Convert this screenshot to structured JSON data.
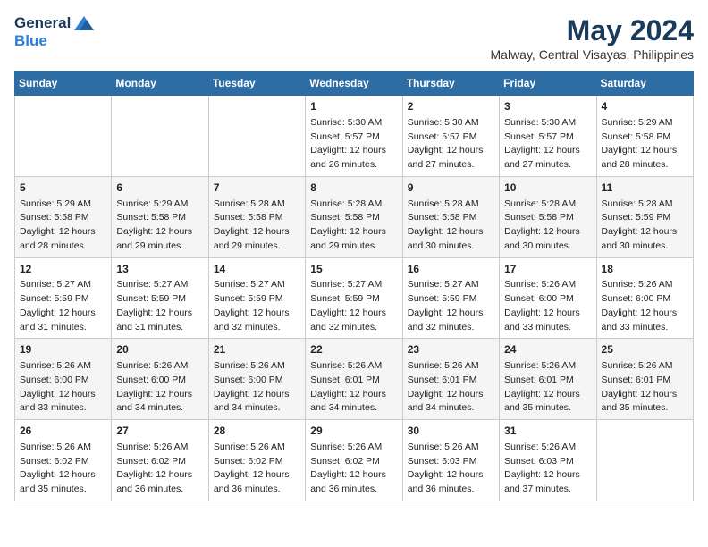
{
  "logo": {
    "general": "General",
    "blue": "Blue"
  },
  "title": "May 2024",
  "subtitle": "Malway, Central Visayas, Philippines",
  "days": [
    "Sunday",
    "Monday",
    "Tuesday",
    "Wednesday",
    "Thursday",
    "Friday",
    "Saturday"
  ],
  "weeks": [
    [
      {
        "day": "",
        "data": ""
      },
      {
        "day": "",
        "data": ""
      },
      {
        "day": "",
        "data": ""
      },
      {
        "day": "1",
        "data": "Sunrise: 5:30 AM\nSunset: 5:57 PM\nDaylight: 12 hours\nand 26 minutes."
      },
      {
        "day": "2",
        "data": "Sunrise: 5:30 AM\nSunset: 5:57 PM\nDaylight: 12 hours\nand 27 minutes."
      },
      {
        "day": "3",
        "data": "Sunrise: 5:30 AM\nSunset: 5:57 PM\nDaylight: 12 hours\nand 27 minutes."
      },
      {
        "day": "4",
        "data": "Sunrise: 5:29 AM\nSunset: 5:58 PM\nDaylight: 12 hours\nand 28 minutes."
      }
    ],
    [
      {
        "day": "5",
        "data": "Sunrise: 5:29 AM\nSunset: 5:58 PM\nDaylight: 12 hours\nand 28 minutes."
      },
      {
        "day": "6",
        "data": "Sunrise: 5:29 AM\nSunset: 5:58 PM\nDaylight: 12 hours\nand 29 minutes."
      },
      {
        "day": "7",
        "data": "Sunrise: 5:28 AM\nSunset: 5:58 PM\nDaylight: 12 hours\nand 29 minutes."
      },
      {
        "day": "8",
        "data": "Sunrise: 5:28 AM\nSunset: 5:58 PM\nDaylight: 12 hours\nand 29 minutes."
      },
      {
        "day": "9",
        "data": "Sunrise: 5:28 AM\nSunset: 5:58 PM\nDaylight: 12 hours\nand 30 minutes."
      },
      {
        "day": "10",
        "data": "Sunrise: 5:28 AM\nSunset: 5:58 PM\nDaylight: 12 hours\nand 30 minutes."
      },
      {
        "day": "11",
        "data": "Sunrise: 5:28 AM\nSunset: 5:59 PM\nDaylight: 12 hours\nand 30 minutes."
      }
    ],
    [
      {
        "day": "12",
        "data": "Sunrise: 5:27 AM\nSunset: 5:59 PM\nDaylight: 12 hours\nand 31 minutes."
      },
      {
        "day": "13",
        "data": "Sunrise: 5:27 AM\nSunset: 5:59 PM\nDaylight: 12 hours\nand 31 minutes."
      },
      {
        "day": "14",
        "data": "Sunrise: 5:27 AM\nSunset: 5:59 PM\nDaylight: 12 hours\nand 32 minutes."
      },
      {
        "day": "15",
        "data": "Sunrise: 5:27 AM\nSunset: 5:59 PM\nDaylight: 12 hours\nand 32 minutes."
      },
      {
        "day": "16",
        "data": "Sunrise: 5:27 AM\nSunset: 5:59 PM\nDaylight: 12 hours\nand 32 minutes."
      },
      {
        "day": "17",
        "data": "Sunrise: 5:26 AM\nSunset: 6:00 PM\nDaylight: 12 hours\nand 33 minutes."
      },
      {
        "day": "18",
        "data": "Sunrise: 5:26 AM\nSunset: 6:00 PM\nDaylight: 12 hours\nand 33 minutes."
      }
    ],
    [
      {
        "day": "19",
        "data": "Sunrise: 5:26 AM\nSunset: 6:00 PM\nDaylight: 12 hours\nand 33 minutes."
      },
      {
        "day": "20",
        "data": "Sunrise: 5:26 AM\nSunset: 6:00 PM\nDaylight: 12 hours\nand 34 minutes."
      },
      {
        "day": "21",
        "data": "Sunrise: 5:26 AM\nSunset: 6:00 PM\nDaylight: 12 hours\nand 34 minutes."
      },
      {
        "day": "22",
        "data": "Sunrise: 5:26 AM\nSunset: 6:01 PM\nDaylight: 12 hours\nand 34 minutes."
      },
      {
        "day": "23",
        "data": "Sunrise: 5:26 AM\nSunset: 6:01 PM\nDaylight: 12 hours\nand 34 minutes."
      },
      {
        "day": "24",
        "data": "Sunrise: 5:26 AM\nSunset: 6:01 PM\nDaylight: 12 hours\nand 35 minutes."
      },
      {
        "day": "25",
        "data": "Sunrise: 5:26 AM\nSunset: 6:01 PM\nDaylight: 12 hours\nand 35 minutes."
      }
    ],
    [
      {
        "day": "26",
        "data": "Sunrise: 5:26 AM\nSunset: 6:02 PM\nDaylight: 12 hours\nand 35 minutes."
      },
      {
        "day": "27",
        "data": "Sunrise: 5:26 AM\nSunset: 6:02 PM\nDaylight: 12 hours\nand 36 minutes."
      },
      {
        "day": "28",
        "data": "Sunrise: 5:26 AM\nSunset: 6:02 PM\nDaylight: 12 hours\nand 36 minutes."
      },
      {
        "day": "29",
        "data": "Sunrise: 5:26 AM\nSunset: 6:02 PM\nDaylight: 12 hours\nand 36 minutes."
      },
      {
        "day": "30",
        "data": "Sunrise: 5:26 AM\nSunset: 6:03 PM\nDaylight: 12 hours\nand 36 minutes."
      },
      {
        "day": "31",
        "data": "Sunrise: 5:26 AM\nSunset: 6:03 PM\nDaylight: 12 hours\nand 37 minutes."
      },
      {
        "day": "",
        "data": ""
      }
    ]
  ]
}
